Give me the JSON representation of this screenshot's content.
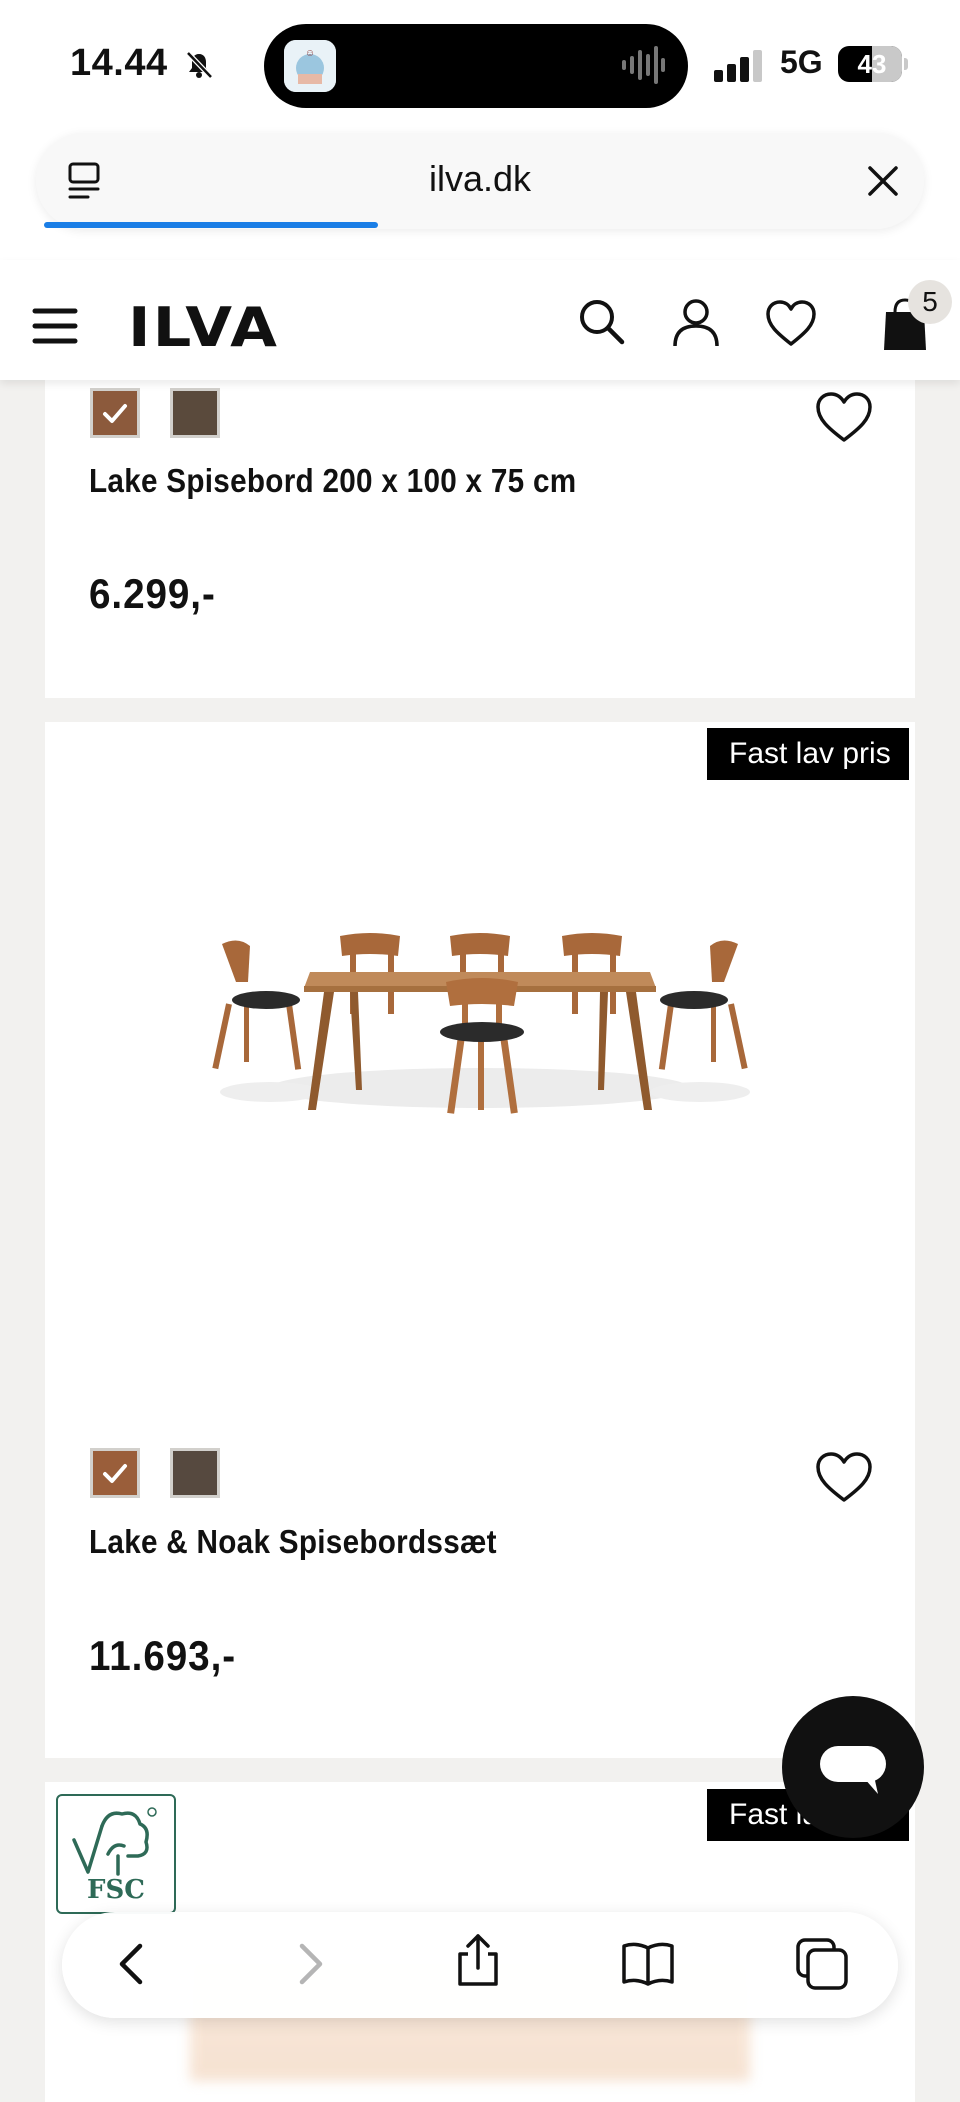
{
  "status_bar": {
    "time": "14.44",
    "network": "5G",
    "battery": "43"
  },
  "browser": {
    "url": "ilva.dk",
    "load_progress": 0.38
  },
  "site_header": {
    "logo": "ILVA",
    "cart_count": "5"
  },
  "products": [
    {
      "title": "Lake Spisebord 200 x 100 x 75 cm",
      "price": "6.299,-",
      "swatches": [
        {
          "color": "#8c5a3c",
          "selected": true
        },
        {
          "color": "#5a4a3c",
          "selected": false
        }
      ]
    },
    {
      "badge": "Fast lav pris",
      "title": "Lake & Noak Spisebordssæt",
      "price": "11.693,-",
      "swatches": [
        {
          "color": "#9a5e3a",
          "selected": true
        },
        {
          "color": "#56493f",
          "selected": false
        }
      ]
    },
    {
      "badge": "Fast la"
    }
  ],
  "fsc_label": "FSC",
  "colors": {
    "accent_blue": "#1a7ee6",
    "badge_bg": "#000000",
    "fsc_green": "#2e6a57"
  }
}
